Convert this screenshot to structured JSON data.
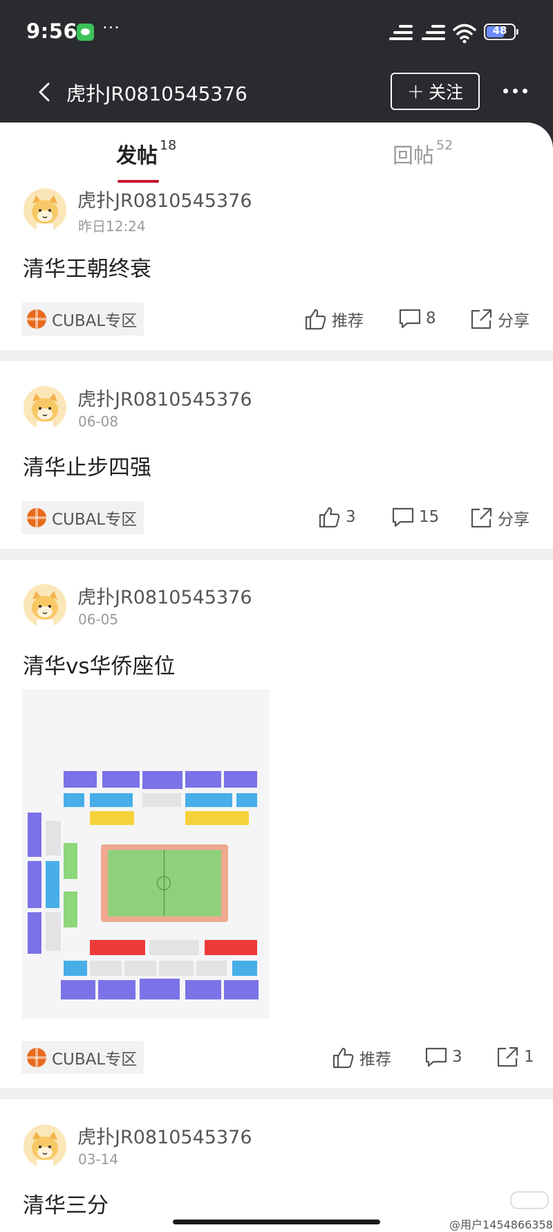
{
  "status_bar": {
    "time": "9:56",
    "battery": "48"
  },
  "nav": {
    "title": "虎扑JR0810545376",
    "follow_label": "关注"
  },
  "tabs": [
    {
      "label": "发帖",
      "count": "18",
      "active": true
    },
    {
      "label": "回帖",
      "count": "52",
      "active": false
    }
  ],
  "posts": [
    {
      "author": "虎扑JR0810545376",
      "date": "昨日12:24",
      "title": "清华王朝终衰",
      "tag": "CUBAL专区",
      "like": "推荐",
      "comments": "8",
      "share": "分享"
    },
    {
      "author": "虎扑JR0810545376",
      "date": "06-08",
      "title": "清华止步四强",
      "tag": "CUBAL专区",
      "like": "3",
      "comments": "15",
      "share": "分享"
    },
    {
      "author": "虎扑JR0810545376",
      "date": "06-05",
      "title": "清华vs华侨座位",
      "tag": "CUBAL专区",
      "like": "推荐",
      "comments": "3",
      "share": "1"
    },
    {
      "author": "虎扑JR0810545376",
      "date": "03-14",
      "title": "清华三分"
    }
  ],
  "watermark": {
    "text": "@用户1454866358"
  },
  "colors": {
    "accent": "#c8102e",
    "header_bg": "#2a2b2f"
  }
}
